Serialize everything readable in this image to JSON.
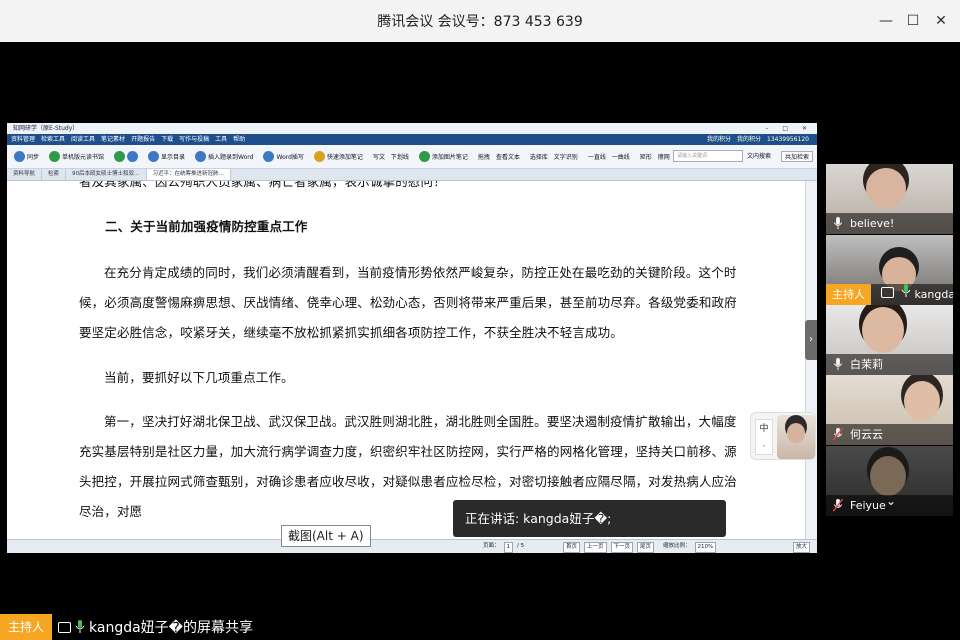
{
  "window": {
    "title": "腾讯会议 会议号：873 453 639",
    "min_label": "—",
    "max_label": "☐",
    "close_label": "✕"
  },
  "shared_app": {
    "title": "知网研学（原E-Study）",
    "window_controls": "– □ ✕",
    "menu": [
      "资料管理",
      "检索工具",
      "阅读工具",
      "笔记素材",
      "开题报告",
      "下载",
      "写作与投稿",
      "工具",
      "帮助"
    ],
    "menu_right": [
      "我的积分",
      "我的积分",
      "13439956120"
    ],
    "toolbar": [
      "同步",
      "单机版元读书馆",
      "显示目录",
      "插入题录到Word",
      "Word插写",
      "快速添加笔记",
      "写文",
      "下划线",
      "添加图片笔记",
      "拖拽",
      "查看文本",
      "选择库",
      "文字识别",
      "一直线",
      "一曲线",
      "矩形",
      "擦网",
      "放大",
      "缩小"
    ],
    "search_placeholder": "请输入关键词",
    "search_btn": "文内搜索",
    "search_scope": "共加检索",
    "tabs": [
      "资料导航",
      "检索",
      "90后本硕女硕士博士和双…",
      "习近平：在统筹推进新冠肺…"
    ],
    "doc": {
      "line_top": "者及其家属、因公殉职人员家属、病亡者家属，表示诚挚的慰问！",
      "heading": "二、关于当前加强疫情防控重点工作",
      "p1": "在充分肯定成绩的同时，我们必须清醒看到，当前疫情形势依然严峻复杂，防控正处在最吃劲的关键阶段。这个时候，必须高度警惕麻痹思想、厌战情绪、侥幸心理、松劲心态，否则将带来严重后果，甚至前功尽弃。各级党委和政府要坚定必胜信念，咬紧牙关，继续毫不放松抓紧抓实抓细各项防控工作，不获全胜决不轻言成功。",
      "p2": "当前，要抓好以下几项重点工作。",
      "p3": "第一，坚决打好湖北保卫战、武汉保卫战。武汉胜则湖北胜，湖北胜则全国胜。要坚决遏制疫情扩散输出，大幅度充实基层特别是社区力量，加大流行病学调查力度，织密织牢社区防控网，实行严格的网格化管理，坚持关口前移、源头把控，开展拉网式筛查甄别，对确诊患者应收尽收，对疑似患者应检尽检，对密切接触者应隔尽隔，对发热病人应治尽治，对愿"
    },
    "status": {
      "page_label": "页面：",
      "page_value": "1",
      "page_of": "/ 5",
      "btn_first": "首页",
      "btn_prev": "上一页",
      "btn_next": "下一页",
      "btn_last": "尾页",
      "zoom_label": "缩放比例：",
      "zoom_value": "210%",
      "btn_fit": "放大"
    }
  },
  "ime_label": "中",
  "ime_label2": "·",
  "tooltip": "截图(Alt + A)",
  "speaking": "正在讲话: kangda妞子�;",
  "participants": [
    {
      "name": "believe!",
      "host": false
    },
    {
      "name": "kangda",
      "host": true,
      "host_label": "主持人"
    },
    {
      "name": "白茉莉",
      "host": false
    },
    {
      "name": "何云云",
      "host": false
    },
    {
      "name": "Feiyue",
      "host": false
    }
  ],
  "bottom": {
    "host_label": "主持人",
    "share_text": "kangda妞子�的屏幕共享"
  }
}
